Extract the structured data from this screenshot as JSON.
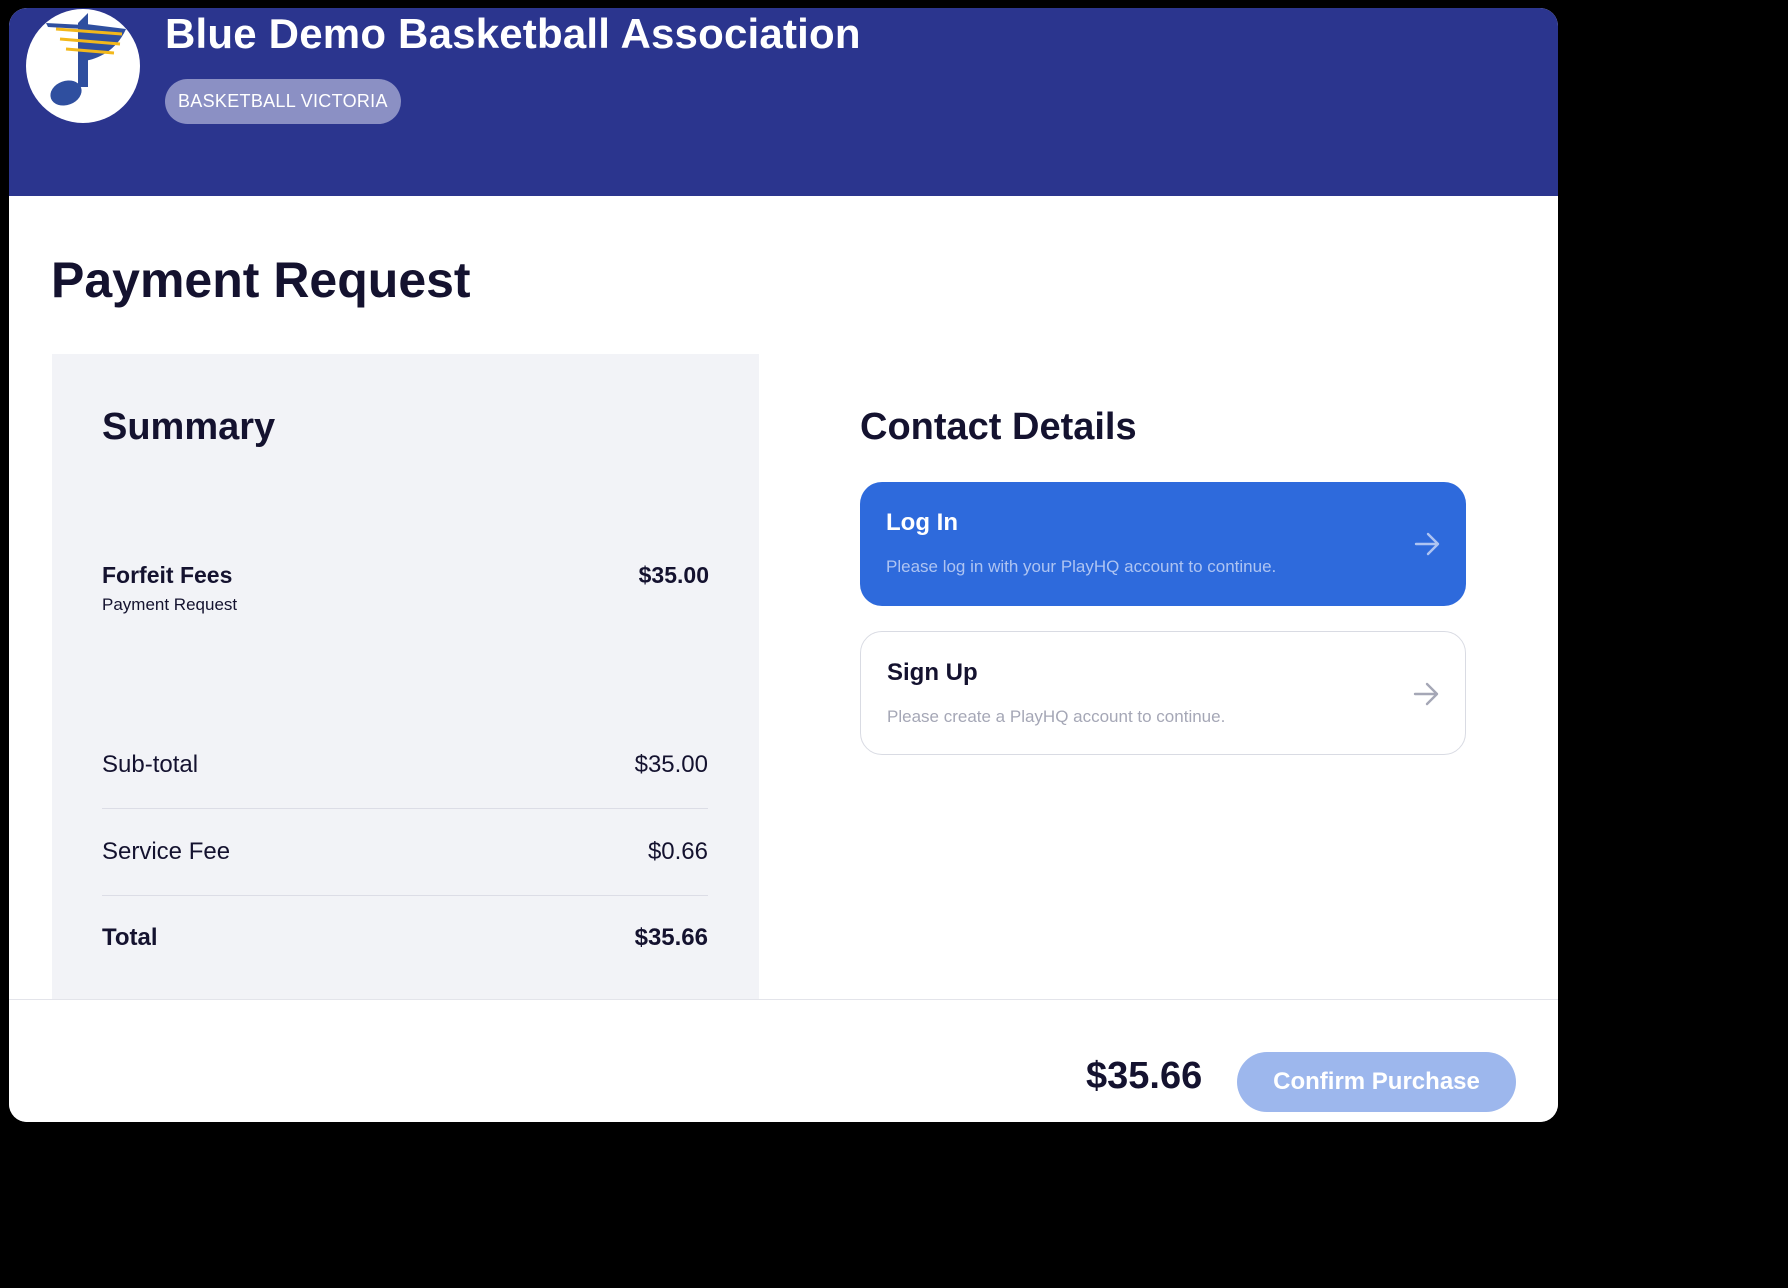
{
  "header": {
    "organisation_name": "Blue Demo Basketball Association",
    "association_badge": "BASKETBALL VICTORIA",
    "logo_icon": "music-note-logo-icon",
    "colors": {
      "banner": "#2b358e",
      "logo_primary": "#2f4f9f",
      "logo_accent": "#f2b81b"
    }
  },
  "page": {
    "title": "Payment Request"
  },
  "summary": {
    "title": "Summary",
    "line_items": [
      {
        "name": "Forfeit Fees",
        "description": "Payment Request",
        "amount": "$35.00"
      }
    ],
    "subtotal_label": "Sub-total",
    "subtotal_value": "$35.00",
    "service_fee_label": "Service Fee",
    "service_fee_value": "$0.66",
    "total_label": "Total",
    "total_value": "$35.66"
  },
  "contact": {
    "title": "Contact Details",
    "login": {
      "title": "Log In",
      "description": "Please log in with your PlayHQ account to continue.",
      "icon": "arrow-right-icon"
    },
    "signup": {
      "title": "Sign Up",
      "description": "Please create a PlayHQ account to continue.",
      "icon": "arrow-right-icon"
    },
    "colors": {
      "login_card": "#2e6adc"
    }
  },
  "footer": {
    "total": "$35.66",
    "confirm_label": "Confirm Purchase",
    "confirm_color": "#9db7ed"
  }
}
